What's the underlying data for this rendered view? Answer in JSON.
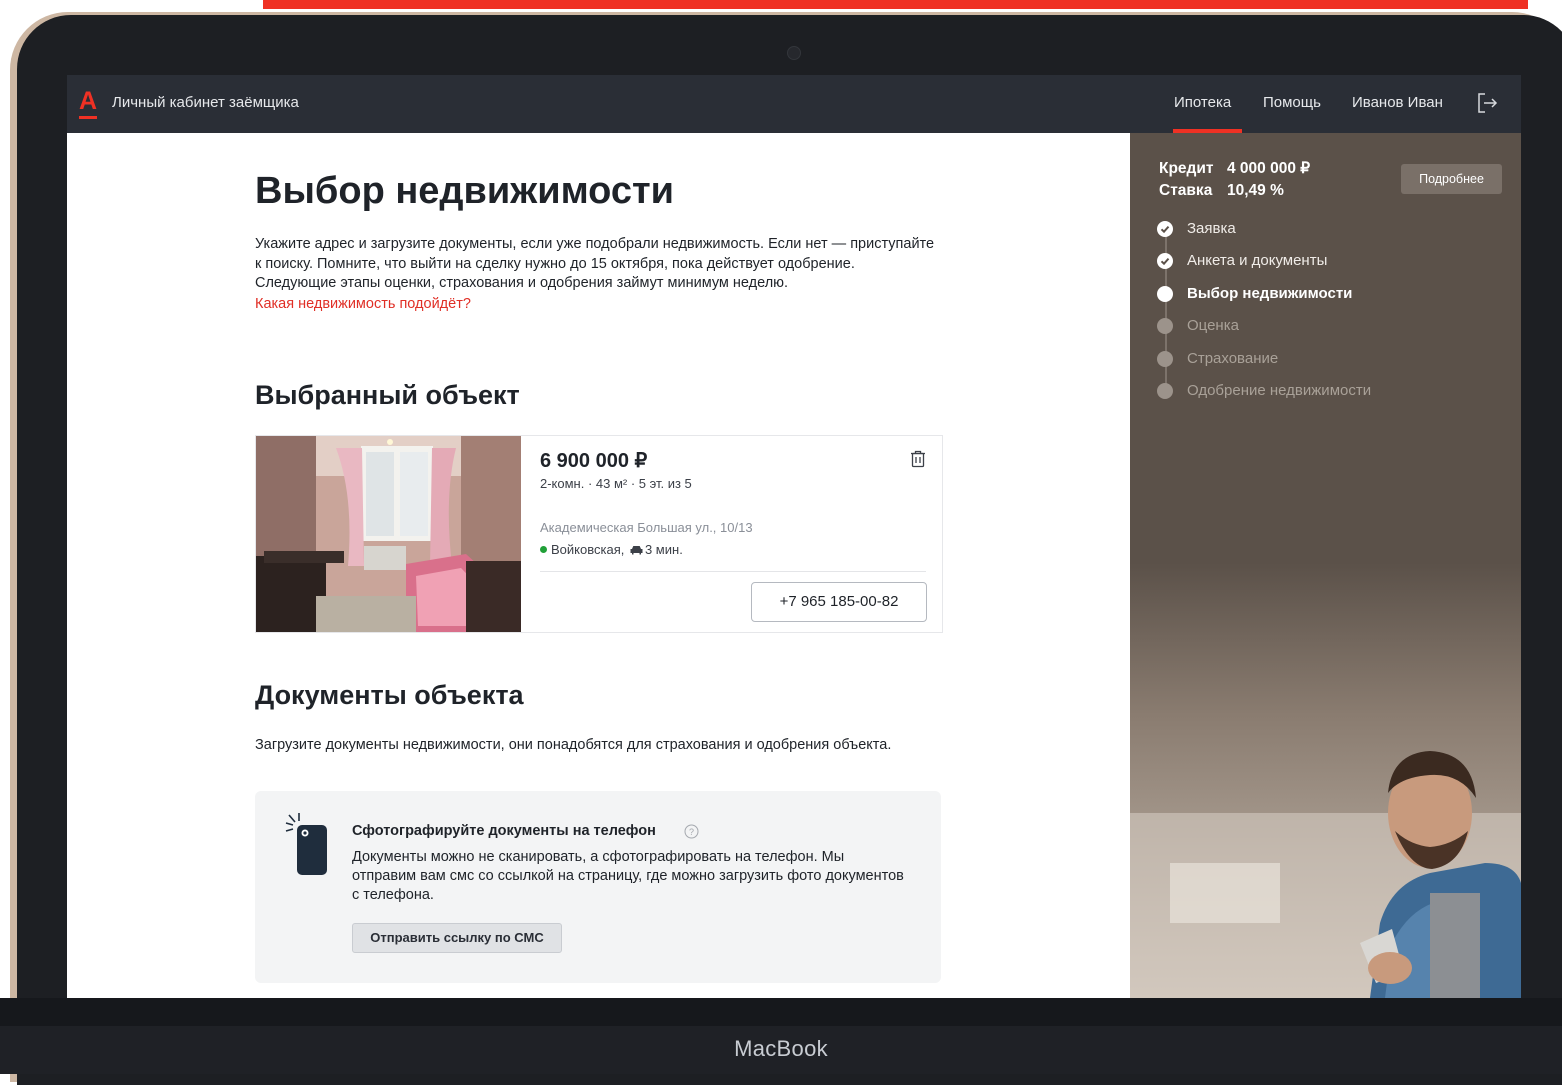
{
  "device": {
    "label": "MacBook"
  },
  "nav": {
    "logo_letter": "А",
    "title": "Личный кабинет заёмщика",
    "links": [
      "Ипотека",
      "Помощь",
      "Иванов Иван"
    ],
    "active_link": "Ипотека"
  },
  "main": {
    "title": "Выбор недвижимости",
    "intro": "Укажите адрес и загрузите документы, если уже подобрали недвижимость. Если нет — приступайте к поиску. Помните, что выйти на сделку нужно до 15 октября, пока действует одобрение. Следующие этапы оценки, страхования и одобрения займут минимум неделю.",
    "intro_link": "Какая недвижимость подойдёт?",
    "selected_heading": "Выбранный объект",
    "docs_heading": "Документы объекта",
    "docs_text": "Загрузите документы недвижимости, они понадобятся для страхования и одобрения объекта."
  },
  "property": {
    "price": "6 900 000 ₽",
    "specs": "2-комн. · 43 м² · 5 эт. из 5",
    "address": "Академическая Большая ул., 10/13",
    "metro": "Войковская,",
    "travel": "3 мин.",
    "phone": "+7 965 185-00-82"
  },
  "tip": {
    "title": "Сфотографируйте документы на телефон",
    "text": "Документы можно не сканировать, а сфотографировать на телефон. Мы отправим вам смс со ссылкой на страницу, где можно загрузить фото документов с телефона.",
    "button": "Отправить ссылку по СМС"
  },
  "sidebar": {
    "credit_label": "Кредит",
    "credit_value": "4 000 000 ₽",
    "rate_label": "Ставка",
    "rate_value": "10,49 %",
    "more_button": "Подробнее",
    "steps": [
      {
        "label": "Заявка",
        "state": "done"
      },
      {
        "label": "Анкета и документы",
        "state": "done"
      },
      {
        "label": "Выбор недвижимости",
        "state": "active"
      },
      {
        "label": "Оценка",
        "state": "pending"
      },
      {
        "label": "Страхование",
        "state": "pending"
      },
      {
        "label": "Одобрение недвижимости",
        "state": "pending"
      }
    ]
  },
  "colors": {
    "accent": "#ef3124",
    "nav_bg": "#2a2e36",
    "sidebar_bg": "#5b5149",
    "metro_green": "#21a038"
  }
}
